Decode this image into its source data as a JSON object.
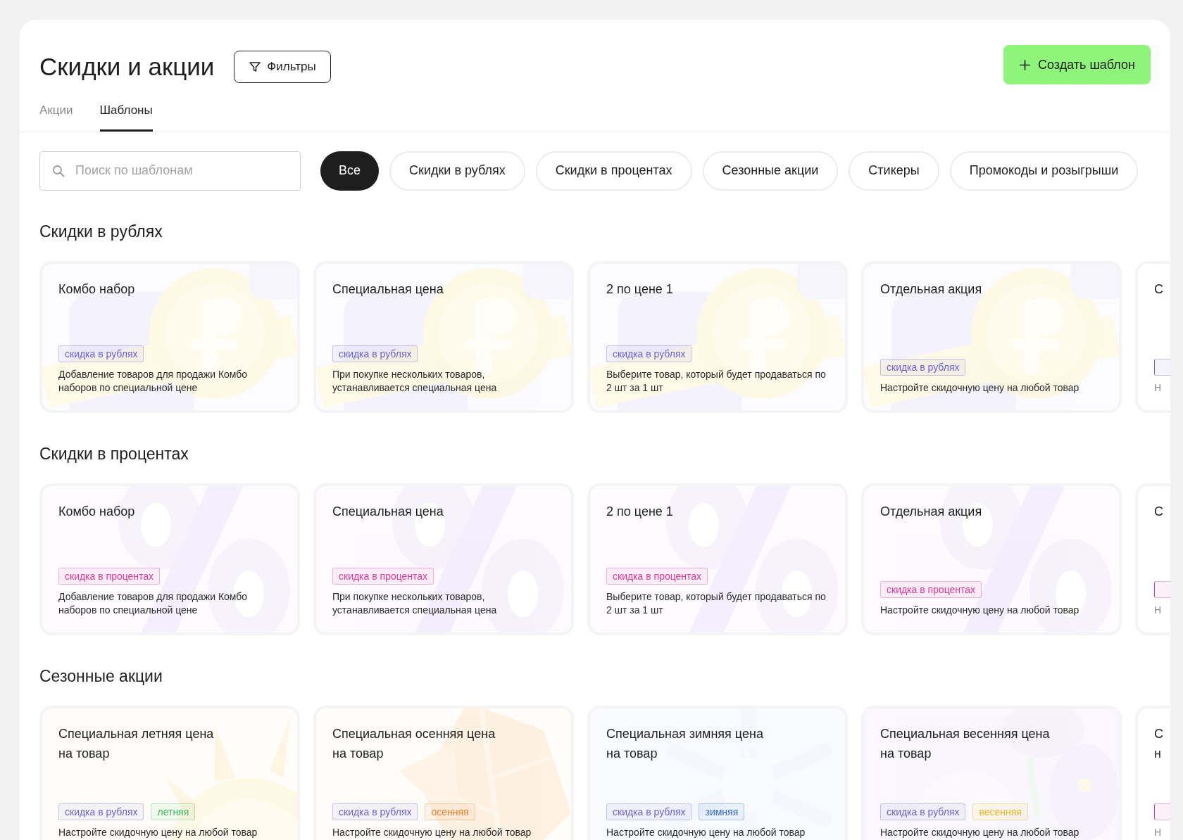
{
  "header": {
    "title": "Скидки и акции",
    "filters_button": "Фильтры",
    "create_button": "Создать шаблон"
  },
  "tabs": [
    {
      "label": "Акции",
      "selected": false
    },
    {
      "label": "Шаблоны",
      "selected": true
    }
  ],
  "search": {
    "placeholder": "Поиск по шаблонам"
  },
  "chips": [
    {
      "label": "Все",
      "selected": true
    },
    {
      "label": "Скидки в рублях",
      "selected": false
    },
    {
      "label": "Скидки в процентах",
      "selected": false
    },
    {
      "label": "Сезонные акции",
      "selected": false
    },
    {
      "label": "Стикеры",
      "selected": false
    },
    {
      "label": "Промокоды и розыгрыши",
      "selected": false
    }
  ],
  "sections": [
    {
      "title": "Скидки в рублях",
      "cards": [
        {
          "title": "Комбо набор",
          "tags": [
            {
              "label": "скидка в рублях",
              "color": "#6c63d9"
            }
          ],
          "description": "Добавление товаров для продажи Комбо наборов по специальной цене"
        },
        {
          "title": "Специальная цена",
          "tags": [
            {
              "label": "скидка в рублях",
              "color": "#6c63d9"
            }
          ],
          "description": "При покупке нескольких товаров, устанавливается специальная цена"
        },
        {
          "title": "2 по цене 1",
          "tags": [
            {
              "label": "скидка в рублях",
              "color": "#6c63d9"
            }
          ],
          "description": "Выберите товар, который будет продаваться по 2 шт за 1 шт"
        },
        {
          "title": "Отдельная акция",
          "tags": [
            {
              "label": "скидка в рублях",
              "color": "#6c63d9"
            }
          ],
          "description": "Настройте скидочную цену на любой товар"
        },
        {
          "title": "С",
          "tags": [
            {
              "color": "#6c63d9"
            }
          ],
          "description": "Н"
        }
      ]
    },
    {
      "title": "Скидки в процентах",
      "cards": [
        {
          "title": "Комбо набор",
          "tags": [
            {
              "label": "скидка в процентах",
              "color": "#e03a95"
            }
          ],
          "description": "Добавление товаров для продажи Комбо наборов по специальной цене"
        },
        {
          "title": "Специальная цена",
          "tags": [
            {
              "label": "скидка в процентах",
              "color": "#e03a95"
            }
          ],
          "description": "При покупке нескольких товаров, устанавливается специальная цена"
        },
        {
          "title": "2 по цене 1",
          "tags": [
            {
              "label": "скидка в процентах",
              "color": "#e03a95"
            }
          ],
          "description": "Выберите товар, который будет продаваться по 2 шт за 1 шт"
        },
        {
          "title": "Отдельная акция",
          "tags": [
            {
              "label": "скидка в процентах",
              "color": "#e03a95"
            }
          ],
          "description": "Настройте скидочную цену на любой товар"
        },
        {
          "title": "С",
          "tags": [
            {
              "color": "#e03a95"
            }
          ],
          "description": "Н"
        }
      ]
    },
    {
      "title": "Сезонные акции",
      "cards": [
        {
          "title": "Специальная летняя цена\nна товар",
          "tags": [
            {
              "label": "скидка в рублях",
              "color": "#6c63d9"
            },
            {
              "label": "летняя",
              "color": "#3dbd5a"
            }
          ],
          "description": "Настройте скидочную цену на любой товар"
        },
        {
          "title": "Специальная осенняя цена\nна товар",
          "tags": [
            {
              "label": "скидка в рублях",
              "color": "#6c63d9"
            },
            {
              "label": "осенняя",
              "color": "#f0802f"
            }
          ],
          "description": "Настройте скидочную цену на любой товар"
        },
        {
          "title": "Специальная зимняя цена\nна товар",
          "tags": [
            {
              "label": "скидка в рублях",
              "color": "#6c63d9"
            },
            {
              "label": "зимняя",
              "color": "#2f68e8"
            }
          ],
          "description": "Настройте скидочную цену на любой товар"
        },
        {
          "title": "Специальная весенняя цена\nна товар",
          "tags": [
            {
              "label": "скидка в рублях",
              "color": "#6c63d9"
            },
            {
              "label": "весенняя",
              "color": "#eab51f"
            }
          ],
          "description": "Настройте скидочную цену на любой товар"
        },
        {
          "title": "С\nн",
          "tags": [
            {
              "color": "#e03a95"
            }
          ],
          "description": "Н"
        }
      ]
    }
  ]
}
